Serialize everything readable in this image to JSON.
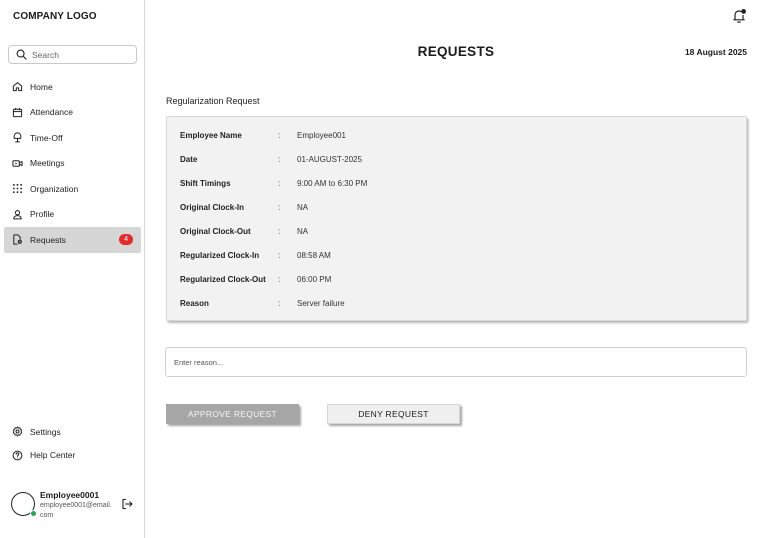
{
  "app": {
    "logo_text": "COMPANY LOGO"
  },
  "search": {
    "placeholder": "Search"
  },
  "sidebar": {
    "items": [
      {
        "label": "Home",
        "icon": "home-icon"
      },
      {
        "label": "Attendance",
        "icon": "calendar-icon"
      },
      {
        "label": "Time-Off",
        "icon": "umbrella-icon"
      },
      {
        "label": "Meetings",
        "icon": "video-icon"
      },
      {
        "label": "Organization",
        "icon": "grid-icon"
      },
      {
        "label": "Profile",
        "icon": "user-icon"
      },
      {
        "label": "Requests",
        "icon": "document-icon",
        "badge": "4",
        "active": true
      }
    ],
    "bottom_items": [
      {
        "label": "Settings",
        "icon": "gear-icon"
      },
      {
        "label": "Help Center",
        "icon": "help-icon"
      }
    ]
  },
  "user": {
    "name": "Employee0001",
    "email": "employee0001@email.com",
    "status": "online"
  },
  "header": {
    "title": "REQUESTS",
    "date": "18 August 2025"
  },
  "request": {
    "section_title": "Regularization Request",
    "separator": ":",
    "fields": [
      {
        "label": "Employee Name",
        "value": "Employee001"
      },
      {
        "label": "Date",
        "value": "01-AUGUST-2025"
      },
      {
        "label": "Shift Timings",
        "value": "9:00 AM to 6:30 PM"
      },
      {
        "label": "Original Clock-In",
        "value": "NA"
      },
      {
        "label": "Original Clock-Out",
        "value": "NA"
      },
      {
        "label": "Regularized Clock-In",
        "value": "08:58 AM"
      },
      {
        "label": "Regularized Clock-Out",
        "value": "06:00 PM"
      },
      {
        "label": "Reason",
        "value": "Server failure"
      }
    ]
  },
  "reason_input": {
    "placeholder": "Enter reason...",
    "value": ""
  },
  "actions": {
    "approve_label": "APPROVE REQUEST",
    "deny_label": "DENY REQUEST"
  },
  "colors": {
    "badge": "#e02d2d",
    "active_nav": "#d6d6d6",
    "status_online": "#2aa44f",
    "approve_button": "#a6a6a6"
  }
}
